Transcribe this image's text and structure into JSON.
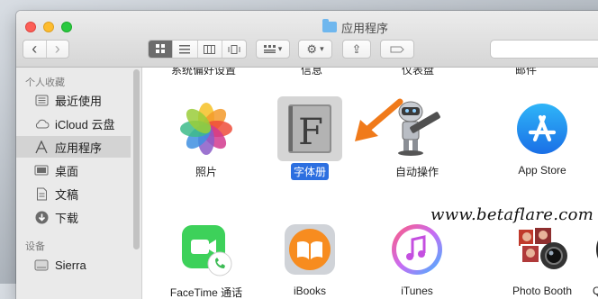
{
  "window": {
    "title": "应用程序"
  },
  "toolbar": {
    "back": "‹",
    "forward": "›",
    "share_glyph": "⇪",
    "action_glyph": "⚙",
    "arrange_glyph": "▾"
  },
  "sidebar": {
    "favorites_header": "个人收藏",
    "favorites": [
      {
        "label": "最近使用",
        "icon": "recents-icon"
      },
      {
        "label": "iCloud 云盘",
        "icon": "cloud-icon"
      },
      {
        "label": "应用程序",
        "icon": "applications-icon",
        "selected": true
      },
      {
        "label": "桌面",
        "icon": "desktop-icon"
      },
      {
        "label": "文稿",
        "icon": "documents-icon"
      },
      {
        "label": "下载",
        "icon": "downloads-icon"
      }
    ],
    "devices_header": "设备",
    "devices": [
      {
        "label": "Sierra",
        "icon": "disk-icon"
      }
    ]
  },
  "content": {
    "cutoff_row": [
      "系统偏好设置",
      "信息",
      "仪表盘",
      "邮件"
    ],
    "row1": [
      {
        "label": "照片",
        "icon": "photos-icon"
      },
      {
        "label": "字体册",
        "icon": "font-book-icon",
        "selected": true
      },
      {
        "label": "自动操作",
        "icon": "automator-icon"
      },
      {
        "label": "App Store",
        "icon": "app-store-icon"
      }
    ],
    "row2": [
      {
        "label": "FaceTime 通话",
        "icon": "facetime-icon"
      },
      {
        "label": "iBooks",
        "icon": "ibooks-icon"
      },
      {
        "label": "iTunes",
        "icon": "itunes-icon"
      },
      {
        "label": "Photo Booth",
        "icon": "photo-booth-icon"
      },
      {
        "label": "Q",
        "icon": "quicktime-icon"
      }
    ],
    "watermark": "www.betaflare.com"
  },
  "colors": {
    "selection": "#2c6fe0",
    "arrow": "#f07a1a"
  }
}
